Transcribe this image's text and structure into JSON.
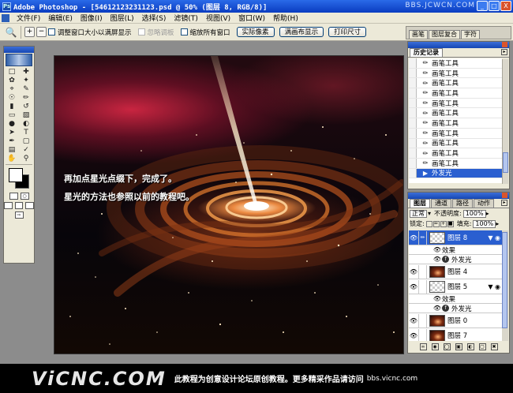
{
  "window": {
    "title": "Adobe Photoshop - [54612123231123.psd @ 50% (图层 8, RGB/8)]",
    "watermark": "BBS.JCWCN.COM",
    "buttons": [
      "_",
      "□",
      "X"
    ]
  },
  "menu": [
    "文件(F)",
    "编辑(E)",
    "图像(I)",
    "图层(L)",
    "选择(S)",
    "滤镜(T)",
    "视图(V)",
    "窗口(W)",
    "帮助(H)"
  ],
  "options": {
    "check_resize": "调整窗口大小以满屏显示",
    "check_ignore_palettes": "忽略调板",
    "check_zoom_all": "缩放所有窗口",
    "btn_actual": "实际像素",
    "btn_fit": "满画布显示",
    "btn_print": "打印尺寸"
  },
  "palette_well": [
    "画笔",
    "图层复合",
    "字符"
  ],
  "canvas": {
    "caption_line1": "再加点星光点缀下，完成了。",
    "caption_line2": "星光的方法也参照以前的教程吧。"
  },
  "history": {
    "tab": "历史记录",
    "items": [
      "画笔工具",
      "画笔工具",
      "画笔工具",
      "画笔工具",
      "画笔工具",
      "画笔工具",
      "画笔工具",
      "画笔工具",
      "画笔工具",
      "画笔工具",
      "画笔工具"
    ],
    "selected_item": "外发光"
  },
  "layers": {
    "tabs": [
      "图层",
      "通道",
      "路径",
      "动作"
    ],
    "blend_mode": "正常",
    "opacity_label": "不透明度:",
    "opacity_value": "100%",
    "lock_label": "锁定:",
    "fill_label": "填充:",
    "fill_value": "100%",
    "rows": [
      {
        "name": "图层 8"
      },
      {
        "name": "效果"
      },
      {
        "name": "外发光"
      },
      {
        "name": "图层 4"
      },
      {
        "name": "图层 5"
      },
      {
        "name": "效果"
      },
      {
        "name": "外发光"
      },
      {
        "name": "图层 0"
      },
      {
        "name": "图层 7"
      }
    ]
  },
  "footer": {
    "logo": "ViCNC.COM",
    "note": "此教程为创意设计论坛原创教程。更多精采作品请访问",
    "site": "bbs.vicnc.com"
  },
  "colors": {
    "title_blue": "#0a3cc0",
    "chrome": "#ece9d8",
    "selection": "#2a5fd0",
    "footer": "#000000"
  }
}
